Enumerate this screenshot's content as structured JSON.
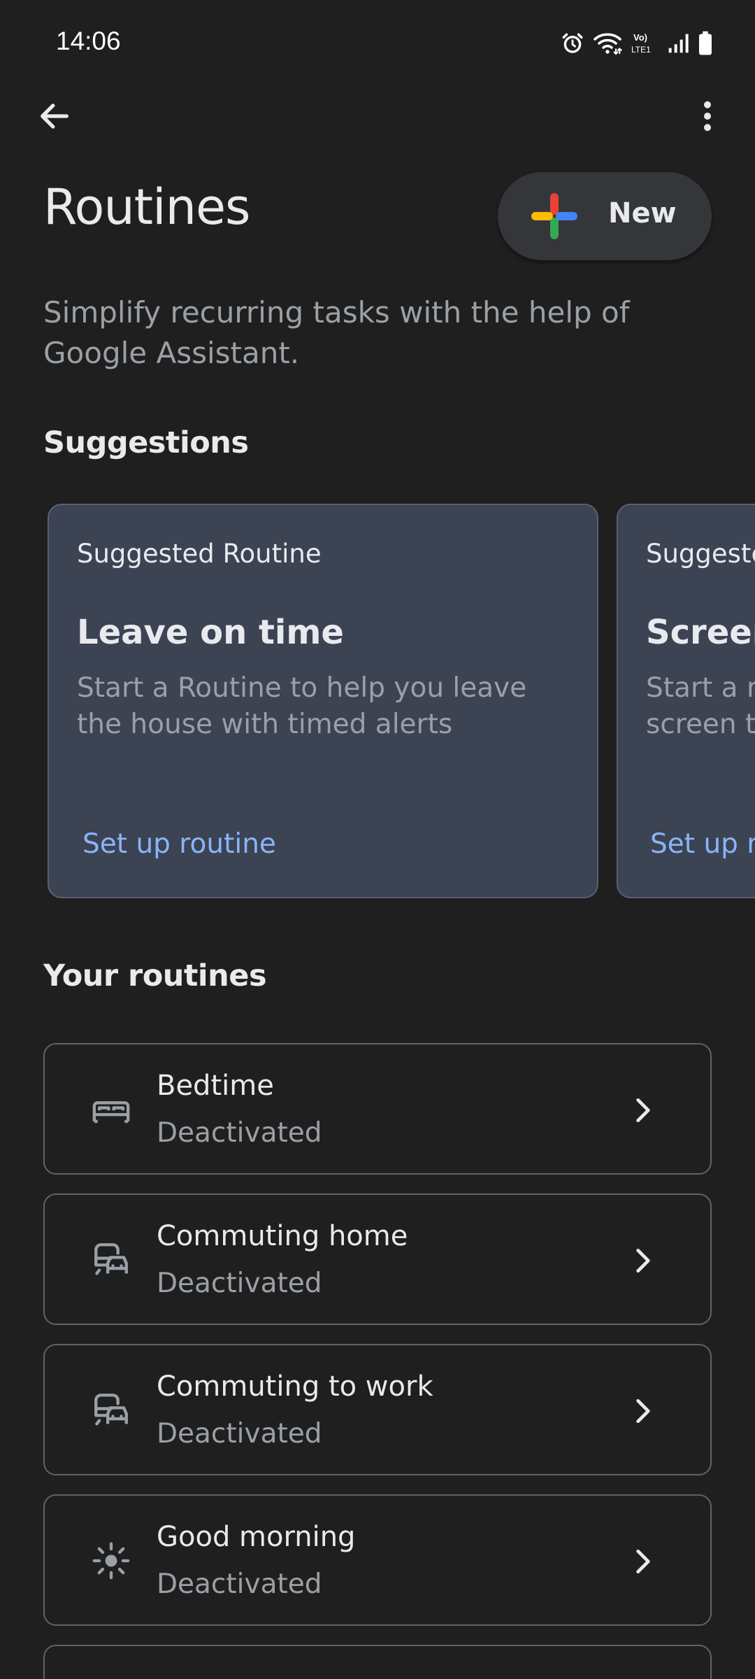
{
  "status_bar": {
    "time": "14:06",
    "icons": [
      "alarm-icon",
      "wifi-icon",
      "volte-lte-icon",
      "signal-icon",
      "battery-icon"
    ]
  },
  "app_bar": {
    "back_icon": "arrow-back-icon",
    "menu_icon": "more-vert-icon"
  },
  "header": {
    "title": "Routines",
    "new_button_label": "New",
    "subtitle": "Simplify recurring tasks with the help of Google Assistant."
  },
  "suggestions": {
    "heading": "Suggestions",
    "cards": [
      {
        "eyebrow": "Suggested Routine",
        "title": "Leave on time",
        "description": "Start a Routine to help you leave the house with timed alerts",
        "action": "Set up routine"
      },
      {
        "eyebrow": "Suggested Routine",
        "title": "Screen",
        "description": "Start a r screen t",
        "action": "Set up r"
      }
    ]
  },
  "your_routines": {
    "heading": "Your routines",
    "items": [
      {
        "name": "Bedtime",
        "status": "Deactivated",
        "icon": "bed-icon"
      },
      {
        "name": "Commuting home",
        "status": "Deactivated",
        "icon": "commute-icon"
      },
      {
        "name": "Commuting to work",
        "status": "Deactivated",
        "icon": "commute-icon"
      },
      {
        "name": "Good morning",
        "status": "Deactivated",
        "icon": "sun-icon"
      }
    ]
  },
  "colors": {
    "background": "#1f1f1f",
    "card_suggestion": "#3c4353",
    "accent_link": "#8ab4f8",
    "google_blue": "#4285f4",
    "google_red": "#ea4335",
    "google_yellow": "#fbbc04",
    "google_green": "#34a853"
  }
}
